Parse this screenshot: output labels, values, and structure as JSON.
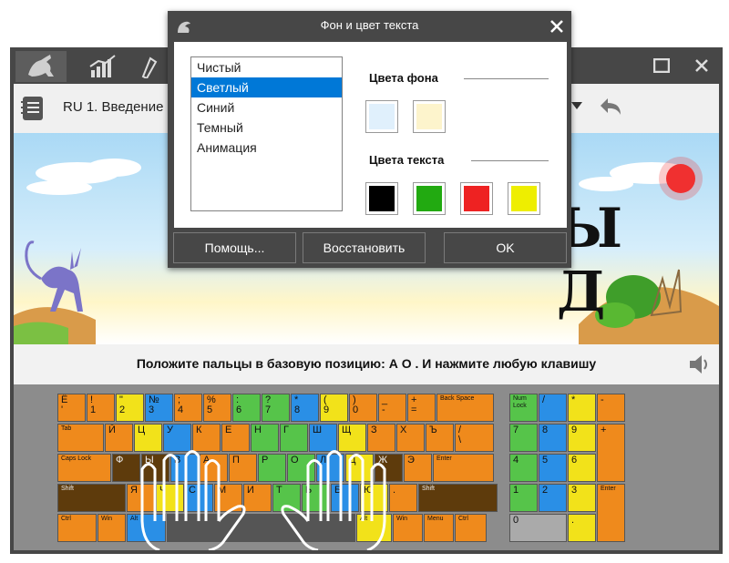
{
  "toolbar": {
    "lesson_title": "RU 1. Введение"
  },
  "scene": {
    "big_letters": "Ы Д"
  },
  "instruction": {
    "text": "Положите пальцы в базовую позицию:  А  О .  И нажмите любую клавишу"
  },
  "keyboard": {
    "row1": [
      {
        "t": "Ё\n'",
        "c": "o"
      },
      {
        "t": "!\n1",
        "c": "o"
      },
      {
        "t": "\"\n2",
        "c": "y"
      },
      {
        "t": "№\n3",
        "c": "b"
      },
      {
        "t": ";\n4",
        "c": "o"
      },
      {
        "t": "%\n5",
        "c": "o"
      },
      {
        "t": ":\n6",
        "c": "g"
      },
      {
        "t": "?\n7",
        "c": "g"
      },
      {
        "t": "*\n8",
        "c": "b"
      },
      {
        "t": "(\n9",
        "c": "y"
      },
      {
        "t": ")\n0",
        "c": "o"
      },
      {
        "t": "_\n-",
        "c": "o"
      },
      {
        "t": "+\n=",
        "c": "o"
      },
      {
        "t": "Back Space",
        "c": "o",
        "s": 1
      }
    ],
    "row2": [
      {
        "t": "Tab",
        "c": "o",
        "s": 1
      },
      {
        "t": "Й",
        "c": "o"
      },
      {
        "t": "Ц",
        "c": "y"
      },
      {
        "t": "У",
        "c": "b"
      },
      {
        "t": "К",
        "c": "o"
      },
      {
        "t": "Е",
        "c": "o"
      },
      {
        "t": "Н",
        "c": "g"
      },
      {
        "t": "Г",
        "c": "g"
      },
      {
        "t": "Ш",
        "c": "b"
      },
      {
        "t": "Щ",
        "c": "y"
      },
      {
        "t": "З",
        "c": "o"
      },
      {
        "t": "Х",
        "c": "o"
      },
      {
        "t": "Ъ",
        "c": "o"
      },
      {
        "t": "/\n\\",
        "c": "o"
      }
    ],
    "row3": [
      {
        "t": "Caps Lock",
        "c": "o",
        "s": 1
      },
      {
        "t": "Ф",
        "c": "br"
      },
      {
        "t": "Ы",
        "c": "br"
      },
      {
        "t": "В",
        "c": "b"
      },
      {
        "t": "А",
        "c": "o"
      },
      {
        "t": "П",
        "c": "o"
      },
      {
        "t": "Р",
        "c": "g"
      },
      {
        "t": "О",
        "c": "g"
      },
      {
        "t": "Л",
        "c": "b"
      },
      {
        "t": "Д",
        "c": "y"
      },
      {
        "t": "Ж",
        "c": "br"
      },
      {
        "t": "Э",
        "c": "o"
      },
      {
        "t": "Enter",
        "c": "o",
        "s": 1
      }
    ],
    "row4": [
      {
        "t": "Shift",
        "c": "br",
        "s": 1
      },
      {
        "t": "Я",
        "c": "o"
      },
      {
        "t": "Ч",
        "c": "y"
      },
      {
        "t": "С",
        "c": "b"
      },
      {
        "t": "М",
        "c": "o"
      },
      {
        "t": "И",
        "c": "o"
      },
      {
        "t": "Т",
        "c": "g"
      },
      {
        "t": "Ь",
        "c": "g"
      },
      {
        "t": "Б",
        "c": "b"
      },
      {
        "t": "Ю",
        "c": "y"
      },
      {
        "t": ".",
        "c": "o"
      },
      {
        "t": "Shift",
        "c": "br",
        "s": 1
      }
    ],
    "row5": [
      {
        "t": "Ctrl",
        "c": "o",
        "s": 1
      },
      {
        "t": "Win",
        "c": "o",
        "s": 1
      },
      {
        "t": "Alt",
        "c": "b",
        "s": 1
      },
      {
        "t": "",
        "c": "dg"
      },
      {
        "t": "Alt",
        "c": "y",
        "s": 1
      },
      {
        "t": "Win",
        "c": "o",
        "s": 1
      },
      {
        "t": "Menu",
        "c": "o",
        "s": 1
      },
      {
        "t": "Ctrl",
        "c": "o",
        "s": 1
      }
    ],
    "numpad": [
      {
        "t": "Num\nLock",
        "c": "g",
        "s": 1
      },
      {
        "t": "/",
        "c": "b"
      },
      {
        "t": "*",
        "c": "y"
      },
      {
        "t": "-",
        "c": "o"
      },
      {
        "t": "7",
        "c": "g"
      },
      {
        "t": "8",
        "c": "b"
      },
      {
        "t": "9",
        "c": "y"
      },
      {
        "t": "+",
        "c": "o"
      },
      {
        "t": "4",
        "c": "g"
      },
      {
        "t": "5",
        "c": "b"
      },
      {
        "t": "6",
        "c": "y"
      },
      {
        "t": "1",
        "c": "g"
      },
      {
        "t": "2",
        "c": "b"
      },
      {
        "t": "3",
        "c": "y"
      },
      {
        "t": "Enter",
        "c": "o",
        "s": 1
      },
      {
        "t": "0",
        "c": "gr"
      },
      {
        "t": ".",
        "c": "y"
      }
    ]
  },
  "dialog": {
    "title": "Фон и цвет текста",
    "themes": [
      "Чистый",
      "Светлый",
      "Синий",
      "Темный",
      "Анимация"
    ],
    "selected_theme": "Светлый",
    "bg_colors_label": "Цвета фона",
    "bg_colors": [
      "#e0f0fc",
      "#fdf4cc"
    ],
    "text_colors_label": "Цвета текста",
    "text_colors": [
      "#000000",
      "#22aa11",
      "#ee2222",
      "#eeee00"
    ],
    "help_button": "Помощь...",
    "restore_button": "Восстановить",
    "ok_button": "OK"
  },
  "colors": {
    "chrome": "#474747",
    "accent": "#0078d7"
  }
}
